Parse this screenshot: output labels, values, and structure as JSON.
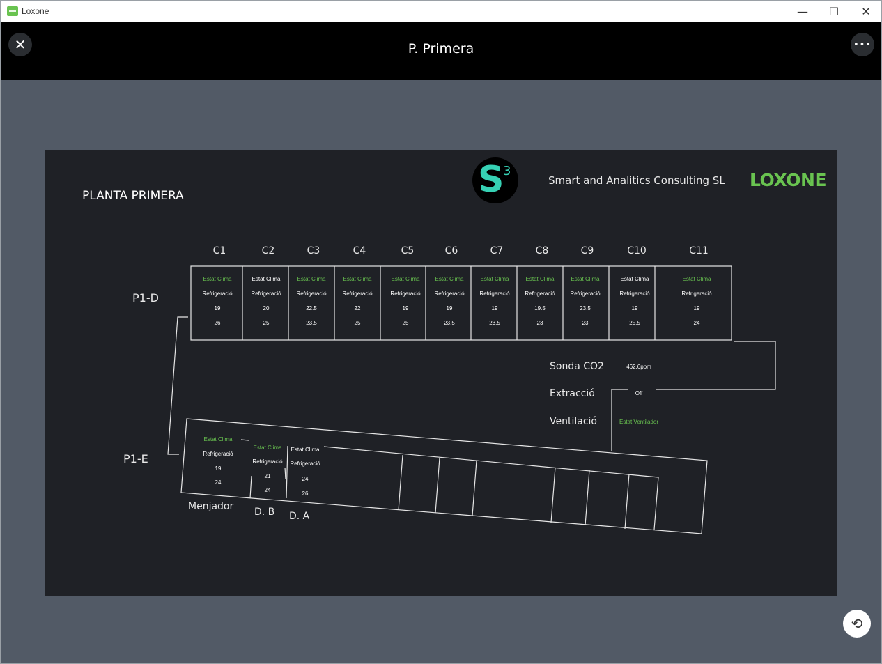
{
  "window": {
    "app_title": "Loxone",
    "minimize": "—",
    "maximize": "☐",
    "close": "✕"
  },
  "header": {
    "title": "P. Primera",
    "close_icon": "✕",
    "more_icon": "•••"
  },
  "plan": {
    "title": "PLANTA PRIMERA",
    "company": "Smart and Analitics Consulting SL",
    "brand": "LOXONE",
    "s3_logo": {
      "letter": "S",
      "superscript": "3"
    },
    "zones": {
      "p1d": "P1-D",
      "p1e": "P1-E"
    },
    "columns": [
      "C1",
      "C2",
      "C3",
      "C4",
      "C5",
      "C6",
      "C7",
      "C8",
      "C9",
      "C10",
      "C11"
    ],
    "cells": [
      {
        "status": "Estat Clima",
        "status_color": "green",
        "mode": "Refrigeració",
        "v1": "19",
        "v2": "26"
      },
      {
        "status": "Estat Clima",
        "status_color": "white",
        "mode": "Refrigeració",
        "v1": "20",
        "v2": "25"
      },
      {
        "status": "Estat Clima",
        "status_color": "green",
        "mode": "Refrigeració",
        "v1": "22.5",
        "v2": "23.5"
      },
      {
        "status": "Estat Clima",
        "status_color": "green",
        "mode": "Refrigeració",
        "v1": "22",
        "v2": "25"
      },
      {
        "status": "Estat Clima",
        "status_color": "green",
        "mode": "Refrigeració",
        "v1": "19",
        "v2": "25"
      },
      {
        "status": "Estat Clima",
        "status_color": "green",
        "mode": "Refrigeració",
        "v1": "19",
        "v2": "23.5"
      },
      {
        "status": "Estat Clima",
        "status_color": "green",
        "mode": "Refrigeració",
        "v1": "19",
        "v2": "23.5"
      },
      {
        "status": "Estat Clima",
        "status_color": "green",
        "mode": "Refrigeració",
        "v1": "19.5",
        "v2": "23"
      },
      {
        "status": "Estat Clima",
        "status_color": "green",
        "mode": "Refrigeració",
        "v1": "23.5",
        "v2": "23"
      },
      {
        "status": "Estat Clima",
        "status_color": "white",
        "mode": "Refrigeració",
        "v1": "19",
        "v2": "25.5"
      },
      {
        "status": "Estat Clima",
        "status_color": "green",
        "mode": "Refrigeració",
        "v1": "19",
        "v2": "24"
      }
    ],
    "sensors": {
      "co2_label": "Sonda CO2",
      "co2_value": "462.6ppm",
      "extract_label": "Extracció",
      "extract_value": "Off",
      "vent_label": "Ventilació",
      "vent_value": "Estat Ventilador"
    },
    "lower_rooms": [
      {
        "name": "Menjador",
        "status": "Estat Clima",
        "status_color": "green",
        "mode": "Refrigeració",
        "v1": "19",
        "v2": "24"
      },
      {
        "name": "D. B",
        "status": "Estat Clima",
        "status_color": "green",
        "mode": "Refrigeració",
        "v1": "21",
        "v2": "24"
      },
      {
        "name": "D. A",
        "status": "Estat Clima",
        "status_color": "white",
        "mode": "Refrigeració",
        "v1": "24",
        "v2": "26"
      }
    ]
  },
  "refresh_icon": "⟲",
  "colors": {
    "accent": "#69c350",
    "teal": "#36d1b4",
    "background": "#525a66",
    "board": "#1f2126"
  }
}
